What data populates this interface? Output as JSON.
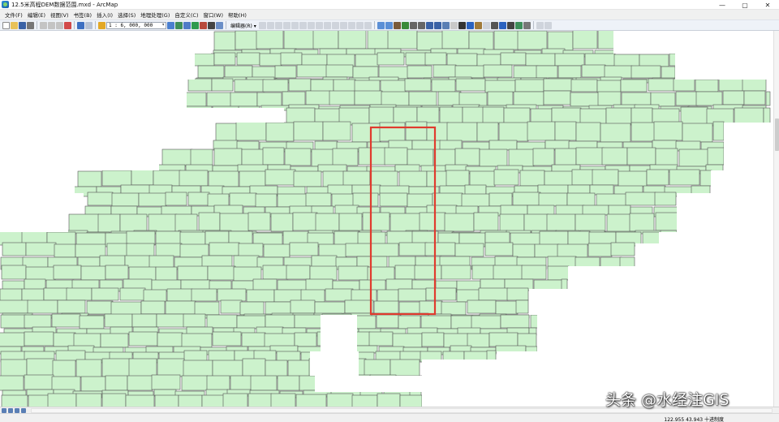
{
  "window": {
    "title": "12.5米高程DEM数据范围.mxd - ArcMap",
    "minimize": "—",
    "maximize": "▢",
    "close": "✕"
  },
  "menu": [
    "文件(F)",
    "编辑(E)",
    "视图(V)",
    "书签(B)",
    "插入(I)",
    "选择(S)",
    "地理处理(G)",
    "自定义(C)",
    "窗口(W)",
    "帮助(H)"
  ],
  "toolbar": {
    "scale": "1 : 6, 000, 000",
    "editor_label": "编辑器(R) ▾"
  },
  "map": {
    "fill_color": "#ccf2cc",
    "stroke_color": "#555555",
    "highlight_color": "#e03b2e"
  },
  "status": {
    "coordinates": "122.955   43.943 十进制度"
  },
  "watermark": "头条 @水经注GIS"
}
